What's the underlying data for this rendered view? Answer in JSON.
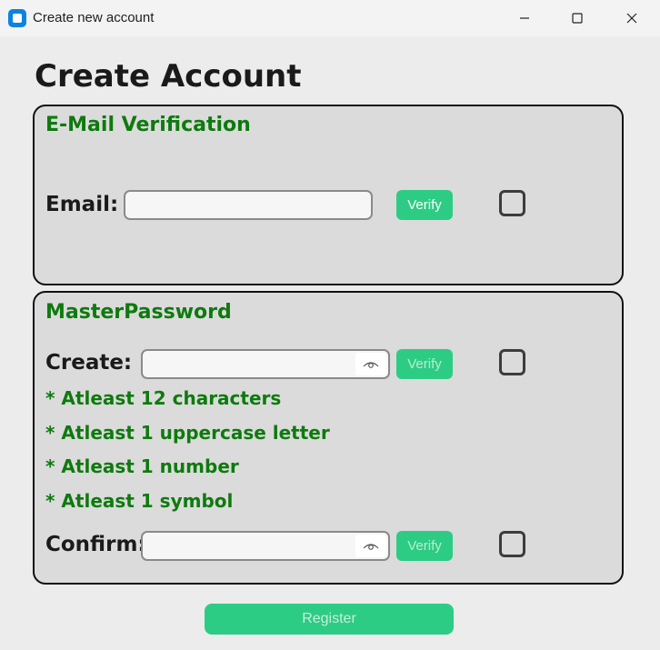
{
  "window": {
    "title": "Create new account",
    "icons": {
      "app": "app-icon",
      "minimize": "minimize-icon",
      "maximize": "maximize-icon",
      "close": "close-icon"
    }
  },
  "page": {
    "title": "Create Account"
  },
  "email_section": {
    "title": "E-Mail Verification",
    "email_label": "Email:",
    "email_value": "",
    "verify_label": "Verify",
    "checkbox_checked": false
  },
  "master_section": {
    "title": "MasterPassword",
    "create_label": "Create:",
    "create_value": "",
    "create_verify_label": "Verify",
    "create_checkbox_checked": false,
    "rules": [
      "* Atleast 12 characters",
      "* Atleast 1 uppercase letter",
      "* Atleast 1 number",
      "* Atleast 1 symbol"
    ],
    "confirm_label": "Confirm:",
    "confirm_value": "",
    "confirm_verify_label": "Verify",
    "confirm_checkbox_checked": false,
    "show_password_icon": "eye-icon"
  },
  "register_label": "Register",
  "colors": {
    "accent": "#2dcc84",
    "section_title": "#0e7a0e",
    "panel_bg": "#dbdbdb",
    "window_bg": "#ececec"
  }
}
